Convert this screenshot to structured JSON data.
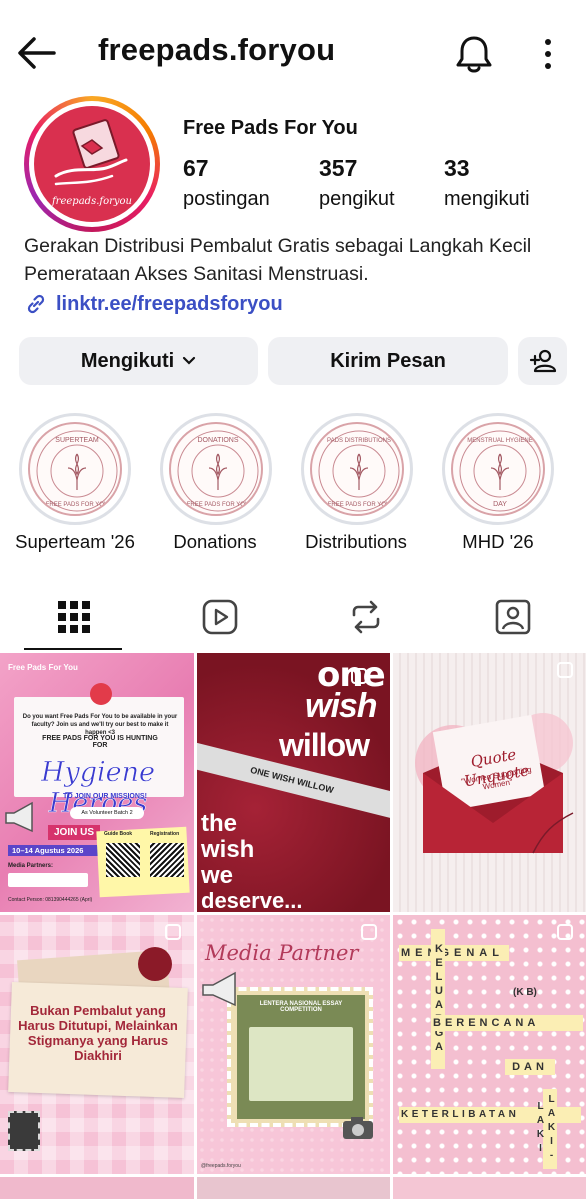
{
  "header": {
    "username": "freepads.foryou",
    "back_icon": "arrow-left-icon",
    "bell_icon": "bell-icon",
    "menu_icon": "more-vertical-icon"
  },
  "profile": {
    "display_name": "Free Pads For You",
    "avatar_text": "freepads.foryou",
    "stats": [
      {
        "value": "67",
        "label": "postingan"
      },
      {
        "value": "357",
        "label": "pengikut"
      },
      {
        "value": "33",
        "label": "mengikuti"
      }
    ],
    "bio": "Gerakan Distribusi Pembalut Gratis sebagai Langkah Kecil Pemerataan Akses Sanitasi Menstruasi.",
    "link": "linktr.ee/freepadsforyou"
  },
  "actions": {
    "following": "Mengikuti",
    "message": "Kirim Pesan",
    "add_person_icon": "add-person-icon"
  },
  "highlights": [
    {
      "label": "Superteam '26",
      "badge_top": "SUPERTEAM",
      "badge_bottom": "FREE PADS FOR YOU"
    },
    {
      "label": "Donations",
      "badge_top": "DONATIONS",
      "badge_bottom": "FREE PADS FOR YOU"
    },
    {
      "label": "Distributions",
      "badge_top": "PADS DISTRIBUTIONS",
      "badge_bottom": "FREE PADS FOR YOU"
    },
    {
      "label": "MHD '26",
      "badge_top": "MENSTRUAL HYGIENE",
      "badge_bottom": "DAY"
    }
  ],
  "tabs": [
    "grid-icon",
    "reels-icon",
    "reposts-icon",
    "tagged-icon"
  ],
  "posts": {
    "p1": {
      "brand": "Free Pads For You",
      "intro": "Do you want Free Pads For You to be available in your faculty? Join us and we'll try our best to make it happen <3",
      "hunting": "FREE PADS FOR YOU IS HUNTING FOR",
      "headline": "Hygiene Heroes",
      "sub": "TO JOIN OUR MISSIONS!",
      "batch": "As Volunteer Batch 2",
      "join": "JOIN US",
      "dates": "10–14 Agustus 2026",
      "partners": "Media Partners:",
      "contact": "Contact Person: 081390444265 (Apri)",
      "guide": "Guide Book",
      "register": "Registration"
    },
    "p2": {
      "line1": "one",
      "line2": "wish",
      "line3": "willow",
      "line4": "the",
      "line5": "wish",
      "line6": "we",
      "line7": "deserve...",
      "banner": "ONE WISH WILLOW"
    },
    "p3": {
      "title": "Quote Unquote",
      "subtitle": "\"Women Supporting Women\""
    },
    "p4": {
      "text": "Bukan Pembalut yang Harus Ditutupi, Melainkan Stigmanya yang Harus Diakhiri"
    },
    "p5": {
      "title": "Media Partner",
      "poster": "LENTERA NASIONAL ESSAY COMPETITION",
      "footer": "@freepads.foryou"
    },
    "p6": {
      "across1": "MENGENAL",
      "down": "KELUARGA",
      "kb": "(K B)",
      "across2": "BERENCANA",
      "dan": "DAN",
      "across3": "KETERLIBATAN",
      "laki": "LAKI-LAKI"
    }
  },
  "colors": {
    "accent_link": "#3b4fc4",
    "button_bg": "#eff0f3",
    "brand": "#d9304f"
  }
}
